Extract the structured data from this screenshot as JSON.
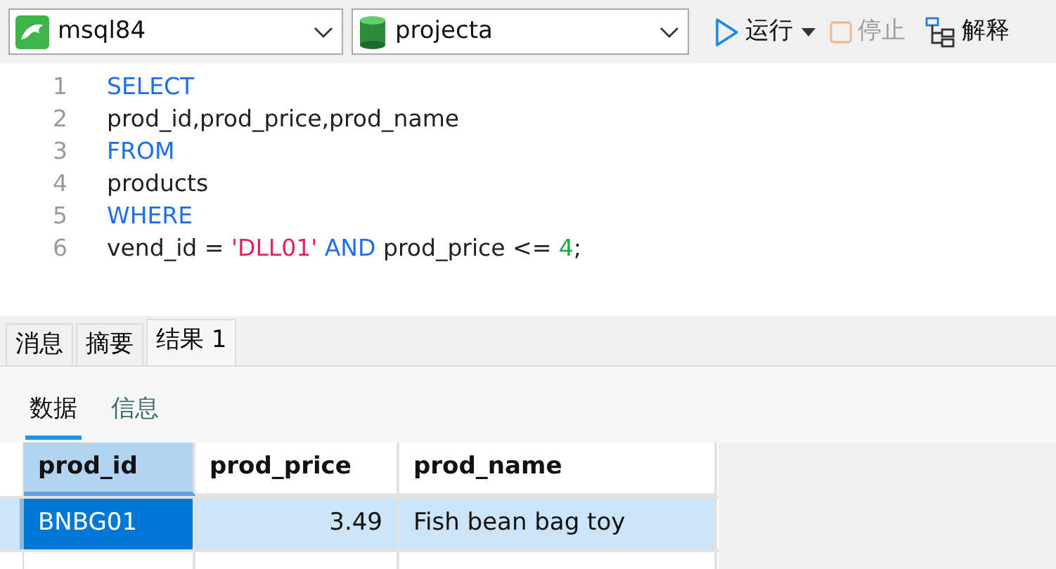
{
  "toolbar": {
    "connection": "msql84",
    "database": "projecta",
    "run": "运行",
    "stop": {
      "label": "停止",
      "disabled": true
    },
    "explain": "解释"
  },
  "editor": {
    "lines": [
      {
        "number": "1",
        "tokens": [
          {
            "text": "SELECT",
            "kind": "keyword"
          }
        ]
      },
      {
        "number": "2",
        "tokens": [
          {
            "text": "prod_id,prod_price,prod_name",
            "kind": "plain"
          }
        ]
      },
      {
        "number": "3",
        "tokens": [
          {
            "text": "FROM",
            "kind": "keyword"
          }
        ]
      },
      {
        "number": "4",
        "tokens": [
          {
            "text": "products",
            "kind": "plain"
          }
        ]
      },
      {
        "number": "5",
        "tokens": [
          {
            "text": "WHERE",
            "kind": "keyword"
          }
        ]
      },
      {
        "number": "6",
        "tokens": [
          {
            "text": "vend_id = ",
            "kind": "plain"
          },
          {
            "text": "'DLL01' ",
            "kind": "string"
          },
          {
            "text": "AND",
            "kind": "keyword"
          },
          {
            "text": " prod_price <= ",
            "kind": "plain"
          },
          {
            "text": "4",
            "kind": "number"
          },
          {
            "text": ";",
            "kind": "plain"
          }
        ]
      }
    ]
  },
  "result_tabs": [
    {
      "label": "消息",
      "selected": false
    },
    {
      "label": "摘要",
      "selected": false
    },
    {
      "label": "结果 1",
      "selected": true
    }
  ],
  "sub_tabs": [
    {
      "label": "数据",
      "selected": true
    },
    {
      "label": "信息",
      "selected": false
    }
  ],
  "table": {
    "columns": [
      {
        "label": "prod_id",
        "selected": true
      },
      {
        "label": "prod_price",
        "selected": false
      },
      {
        "label": "prod_name",
        "selected": false
      }
    ],
    "rows": [
      {
        "selected": true,
        "cells": [
          "BNBG01",
          "3.49",
          "Fish bean bag toy"
        ]
      }
    ]
  }
}
